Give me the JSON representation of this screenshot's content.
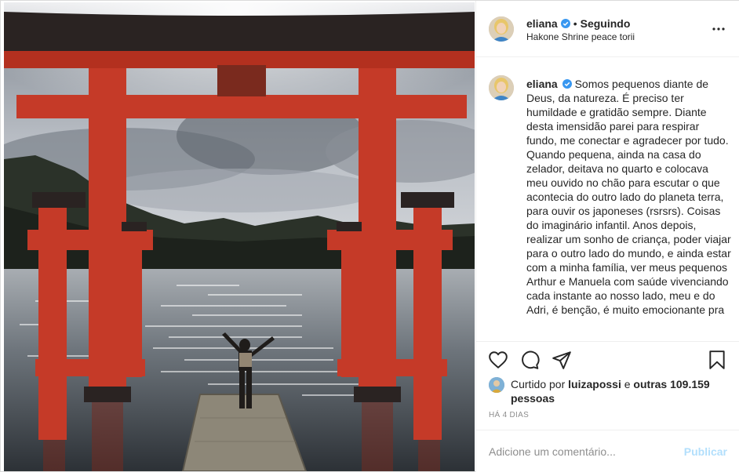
{
  "post": {
    "username": "eliana",
    "verified": true,
    "separator": "•",
    "follow_status": "Seguindo",
    "location": "Hakone Shrine peace torii",
    "caption": "Somos pequenos diante de Deus, da natureza. É preciso ter humildade e gratidão sempre. Diante desta imensidão parei para respirar fundo, me conectar e agradecer por tudo. Quando pequena, ainda na casa do zelador, deitava no quarto e colocava meu ouvido no chão para escutar o que acontecia do outro lado do planeta terra, para ouvir os japoneses (rsrsrs). Coisas do imaginário infantil. Anos depois, realizar um sonho de criança, poder viajar para o outro lado do mundo, e ainda estar com a minha família, ver meus pequenos Arthur e Manuela com saúde vivenciando cada instante ao nosso lado, meu e do Adri, é benção, é muito emocionante pra"
  },
  "likes": {
    "prefix": "Curtido por",
    "liked_by": "luizapossi",
    "connector": "e",
    "others": "outras 109.159 pessoas"
  },
  "timestamp": "HÁ 4 DIAS",
  "comment": {
    "placeholder": "Adicione um comentário...",
    "publish_label": "Publicar"
  },
  "icons": {
    "more": "more-options-icon",
    "like": "heart-icon",
    "comment": "comment-icon",
    "share": "share-icon",
    "save": "bookmark-icon",
    "verified": "verified-badge-icon"
  },
  "colors": {
    "verified_blue": "#3897f0",
    "publish_disabled": "#b2dffc",
    "torii_red": "#c0392b",
    "muted_text": "#8e8e8e"
  }
}
